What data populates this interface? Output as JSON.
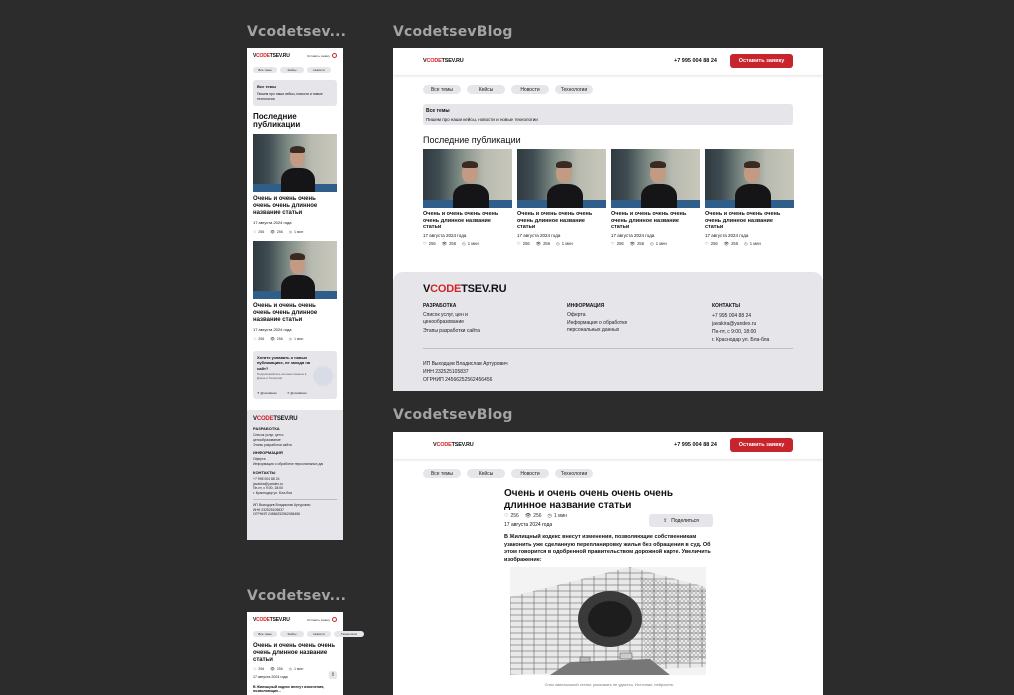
{
  "labels": {
    "frame_mobile_1": "Vcodetsev...",
    "frame_desktop_1": "VcodetsevBlog",
    "frame_desktop_2": "VcodetsevBlog",
    "frame_mobile_2": "Vcodetsev..."
  },
  "brand": {
    "prefix": "V",
    "accent": "CODE",
    "suffix": "TSEV.RU",
    "accent_color": "#d1232a"
  },
  "header": {
    "phone": "+7 995 004 88 24",
    "cta": "Оставить заявку",
    "mobile_cta": "Оставить заявку"
  },
  "tabs": [
    "Все темы",
    "Кейсы",
    "Новости",
    "Технологии"
  ],
  "topic": {
    "title": "Все темы",
    "desc": "Пишем про наши кейсы, новости и новые технологии"
  },
  "mobile_topic": {
    "title": "Все темы",
    "desc": "Пишем про наши кейсы, новости и новые технологии"
  },
  "section_title": "Последние публикации",
  "mobile_section_title": "Последние публикации",
  "cards": [
    {
      "title": "Очень и очень очень очень очень длинное название статьи",
      "date": "17 августа 2024 года",
      "likes": "256",
      "views": "256",
      "read": "1 мин"
    },
    {
      "title": "Очень и очень очень очень очень длинное название статьи",
      "date": "17 августа 2024 года",
      "likes": "256",
      "views": "256",
      "read": "1 мин"
    },
    {
      "title": "Очень и очень очень очень очень длинное название статьи",
      "date": "17 августа 2024 года",
      "likes": "256",
      "views": "256",
      "read": "1 мин"
    },
    {
      "title": "Очень и очень очень очень очень длинное название статьи",
      "date": "17 августа 2024 года",
      "likes": "256",
      "views": "256",
      "read": "1 мин"
    }
  ],
  "subscribe": {
    "text": "Хотите узнавать о новых публикациях, не заходя на сайт?",
    "sub": "Подписывайтесь на наши каналы в Дзене и Телеграм",
    "tg": "@vcodetsev",
    "dzen": "@vcodetsev"
  },
  "footer": {
    "col1_title": "РАЗРАБОТКА",
    "col1_items": [
      "Список услуг, цен и ценообразование",
      "Этапы разработки сайта"
    ],
    "col2_title": "ИНФОРМАЦИЯ",
    "col2_items": [
      "Оферта",
      "Информация о обработке персональных данных"
    ],
    "col3_title": "КОНТАКТЫ",
    "col3_items": [
      "+7 995 004 88 24",
      "javakira@yandex.ru",
      "Пн-пт, с 9:00, 18:00",
      "г. Краснодар ул. Бла-бла"
    ],
    "legal": [
      "ИП Выходцев Владислав Артурович",
      "ИНН 232525105837",
      "ОГРНИП 24566252562456456"
    ]
  },
  "article": {
    "title": "Очень и очень очень очень очень длинное название статьи",
    "likes": "256",
    "views": "256",
    "read": "1 мин",
    "date": "17 августа 2024 года",
    "share": "Поделиться",
    "lead": "В Жилищный кодекс внесут изменения, позволяющие собственникам узаконить уже сделанную перепланировку жилья без обращения в суд. Об этом говорится в одобренной правительством дорожной карте. Увеличить изображение:",
    "caption": "Снос капитальной стены: рисковать не удастся. Источник: нейросеть"
  },
  "mobile_article": {
    "title": "Очень и очень очень очень очень длинное название статьи",
    "likes": "256",
    "views": "256",
    "read": "1 мин",
    "date": "17 августа 2024 года",
    "lead": "В Жилищный кодекс внесут изменения, позволяющие..."
  }
}
